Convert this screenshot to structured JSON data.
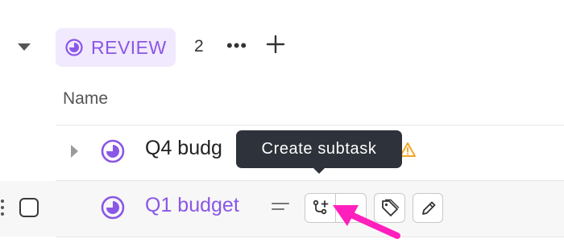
{
  "group": {
    "status_label": "REVIEW",
    "count": "2",
    "more_label": "•••",
    "status_color": "#8a57e6",
    "status_bg": "#f1e9fd"
  },
  "columns": {
    "name_header": "Name"
  },
  "tasks": [
    {
      "title": "Q4 budg",
      "has_subtasks": true,
      "warning": true
    },
    {
      "title": "Q1 budget",
      "checked": false
    }
  ],
  "tooltip": {
    "text": "Create subtask"
  },
  "colors": {
    "accent": "#8a57e6",
    "warning": "#f5a623",
    "annotation_arrow": "#ff1fbd"
  },
  "icons": [
    "caret-down-icon",
    "status-review-icon",
    "more-icon",
    "plus-icon",
    "caret-right-icon",
    "warning-icon",
    "drag-handle-icon",
    "description-lines-icon",
    "create-subtask-icon",
    "chevron-down-icon",
    "tag-icon",
    "edit-pencil-icon"
  ]
}
